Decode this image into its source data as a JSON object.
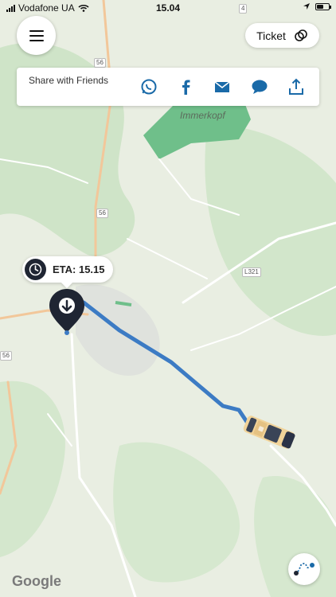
{
  "status_bar": {
    "carrier": "Vodafone UA",
    "time": "15.04",
    "battery_level": 0.6
  },
  "menu": {
    "icon": "menu-icon"
  },
  "ticket": {
    "label": "Ticket",
    "icon": "ticket-icon"
  },
  "share": {
    "title": "Share with Friends",
    "icons": [
      "whatsapp-icon",
      "facebook-icon",
      "mail-icon",
      "message-icon",
      "share-icon"
    ],
    "icon_color": "#1a6aa8"
  },
  "map": {
    "place_label": "Immerkopf",
    "road_numbers": [
      "4",
      "56",
      "56",
      "56",
      "L321"
    ],
    "route_color": "#3c7bc4",
    "attribution": "Google"
  },
  "eta": {
    "text": "ETA: 15.15",
    "icon": "clock-icon"
  },
  "route_button": {
    "icon": "route-icon"
  }
}
